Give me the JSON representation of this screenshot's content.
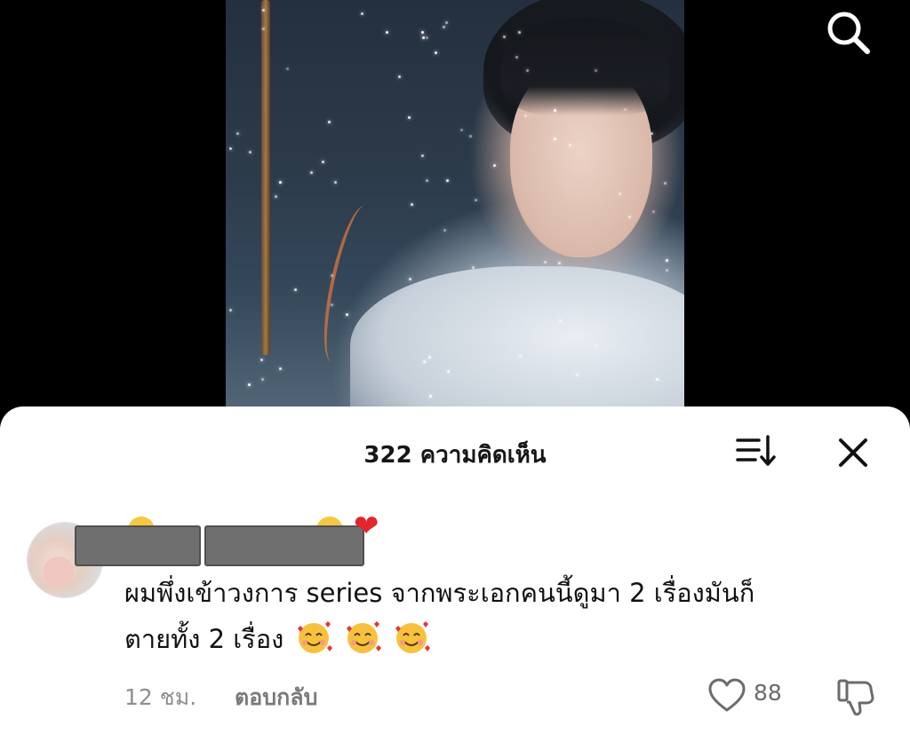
{
  "comments_sheet": {
    "count": "322",
    "title_suffix": "ความคิดเห็น"
  },
  "comment": {
    "text_line1": "ผมพึ่งเข้าวงการ series จากพระเอกคนนี้ดูมา 2 เรื่องมันก็",
    "text_line2": "ตายทั้ง 2 เรื่อง",
    "time": "12 ชม.",
    "reply_label": "ตอบกลับ",
    "like_count": "88"
  },
  "icons": {
    "search": "search-icon",
    "sort": "sort-icon",
    "close": "close-icon",
    "like": "heart-outline-icon",
    "dislike": "thumbs-down-icon",
    "emoji": "smiling-face-with-hearts-icon"
  },
  "colors": {
    "sheet_bg": "#ffffff",
    "page_bg": "#000000",
    "heart_red": "#e3262e",
    "muted_text": "#8e8e8e"
  }
}
